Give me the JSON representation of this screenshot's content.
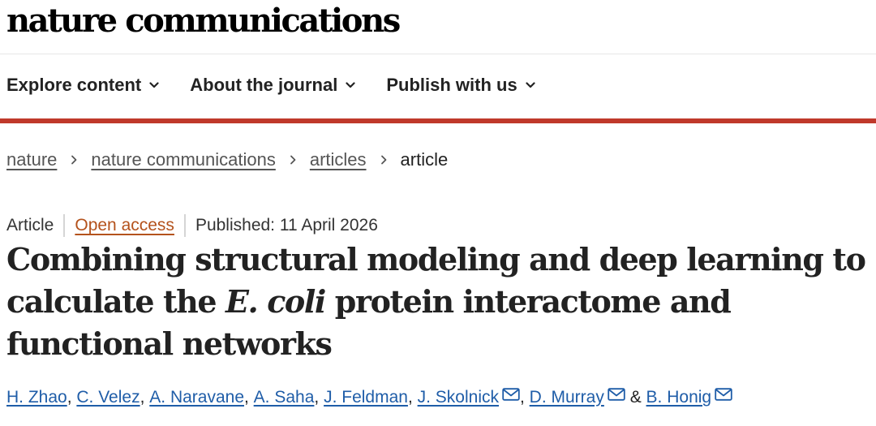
{
  "brand": {
    "name": "nature communications"
  },
  "nav": {
    "items": [
      {
        "label": "Explore content"
      },
      {
        "label": "About the journal"
      },
      {
        "label": "Publish with us"
      }
    ]
  },
  "colors": {
    "accent_rule": "#c0392b",
    "open_access": "#b4521c",
    "author_link": "#1f5da8"
  },
  "breadcrumb": {
    "items": [
      "nature",
      "nature communications",
      "articles"
    ],
    "current": "article"
  },
  "article": {
    "type": "Article",
    "access": "Open access",
    "published": "Published: 11 April 2026",
    "title_part1": "Combining structural modeling and deep learning to calculate the ",
    "title_italic": "E. coli",
    "title_part2": " protein interactome and functional networks",
    "authors": [
      {
        "name": "H. Zhao",
        "email": false
      },
      {
        "name": "C. Velez",
        "email": false
      },
      {
        "name": "A. Naravane",
        "email": false
      },
      {
        "name": "A. Saha",
        "email": false
      },
      {
        "name": "J. Feldman",
        "email": false
      },
      {
        "name": "J. Skolnick",
        "email": true
      },
      {
        "name": "D. Murray",
        "email": true
      },
      {
        "name": "B. Honig",
        "email": true
      }
    ],
    "author_separator": ", ",
    "author_final_separator": " & ",
    "icons": {
      "email": "envelope-icon",
      "chevron": "chevron-down-icon",
      "crumb": "chevron-right-icon"
    }
  }
}
